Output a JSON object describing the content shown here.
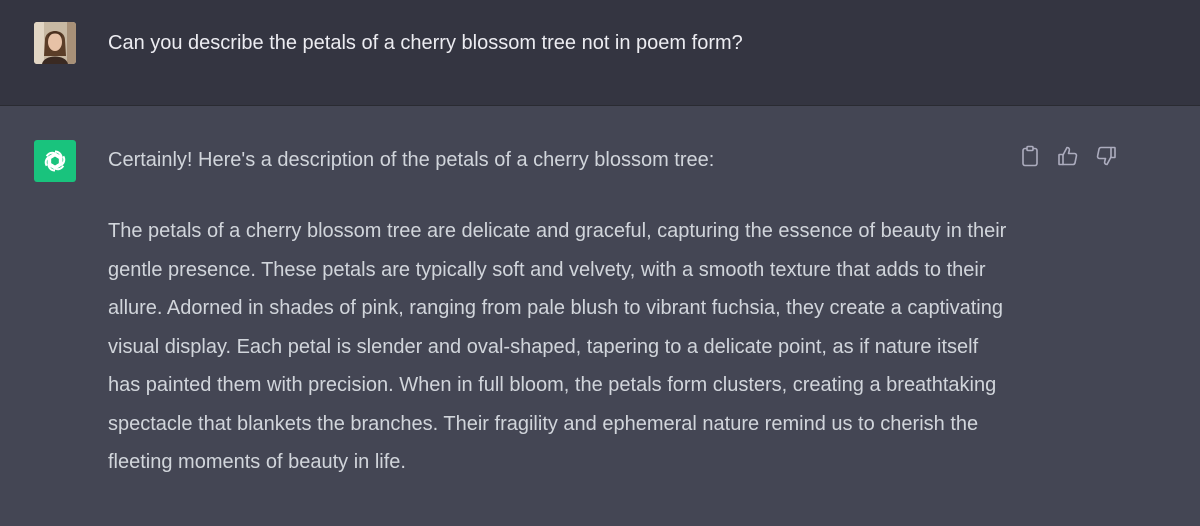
{
  "conversation": {
    "user_message": {
      "text": "Can you describe the petals of a cherry blossom tree not in poem form?",
      "avatar_icon": "user-avatar-photo"
    },
    "assistant_message": {
      "avatar_icon": "openai-logo-icon",
      "intro": "Certainly! Here's a description of the petals of a cherry blossom tree:",
      "paragraph": "The petals of a cherry blossom tree are delicate and graceful, capturing the essence of beauty in their gentle presence. These petals are typically soft and velvety, with a smooth texture that adds to their allure. Adorned in shades of pink, ranging from pale blush to vibrant fuchsia, they create a captivating visual display. Each petal is slender and oval-shaped, tapering to a delicate point, as if nature itself has painted them with precision. When in full bloom, the petals form clusters, creating a breathtaking spectacle that blankets the branches. Their fragility and ephemeral nature remind us to cherish the fleeting moments of beauty in life.",
      "actions": [
        "copy-icon",
        "thumbs-up-icon",
        "thumbs-down-icon"
      ]
    }
  },
  "colors": {
    "user_bg": "#343541",
    "assistant_bg": "#444654",
    "brand_green": "#19c37d",
    "text_primary": "#ececf1",
    "text_assistant": "#d1d5db",
    "icon_gray": "#acacbe"
  }
}
